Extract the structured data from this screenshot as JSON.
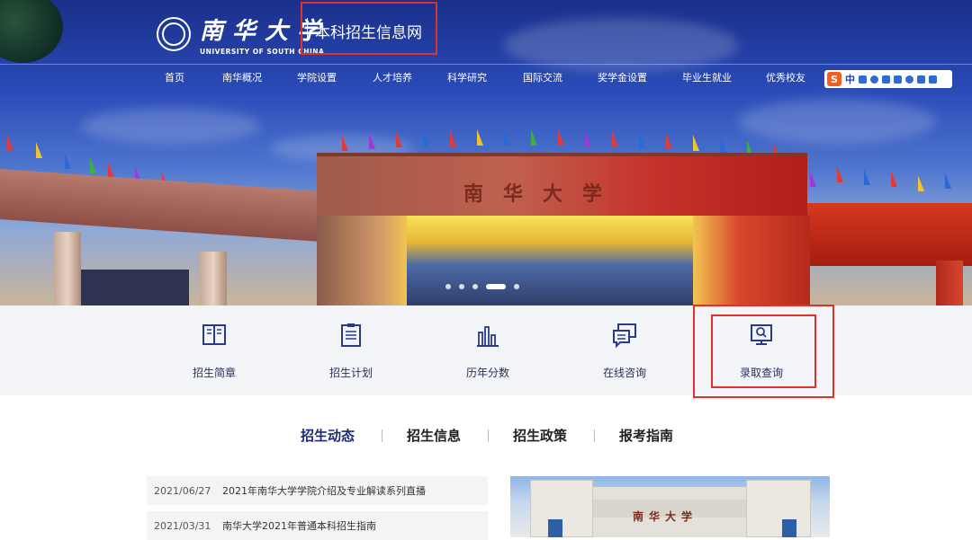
{
  "header": {
    "logo_cn": "南华大学",
    "logo_en": "UNIVERSITY OF SOUTH CHINA",
    "site_title": "本科招生信息网"
  },
  "nav": {
    "items": [
      "首页",
      "南华概况",
      "学院设置",
      "人才培养",
      "科学研究",
      "国际交流",
      "奖学金设置",
      "毕业生就业",
      "优秀校友"
    ]
  },
  "ime": {
    "logo": "S",
    "mode": "中"
  },
  "hero": {
    "gate_text": "南华大学",
    "slide_count": 5,
    "active_slide": 4
  },
  "quick_links": [
    {
      "label": "招生简章",
      "icon": "book-icon"
    },
    {
      "label": "招生计划",
      "icon": "clipboard-icon"
    },
    {
      "label": "历年分数",
      "icon": "bar-chart-icon"
    },
    {
      "label": "在线咨询",
      "icon": "chat-icon"
    },
    {
      "label": "录取查询",
      "icon": "search-monitor-icon"
    }
  ],
  "tabs": [
    "招生动态",
    "招生信息",
    "招生政策",
    "报考指南"
  ],
  "news": [
    {
      "date": "2021/06/27",
      "title": "2021年南华大学学院介绍及专业解读系列直播"
    },
    {
      "date": "2021/03/31",
      "title": "南华大学2021年普通本科招生指南"
    }
  ],
  "photo": {
    "building_text": "南华大学"
  },
  "colors": {
    "accent": "#1e2a78",
    "annotation": "#e0302a",
    "quick_bg": "#f3f4f8"
  }
}
